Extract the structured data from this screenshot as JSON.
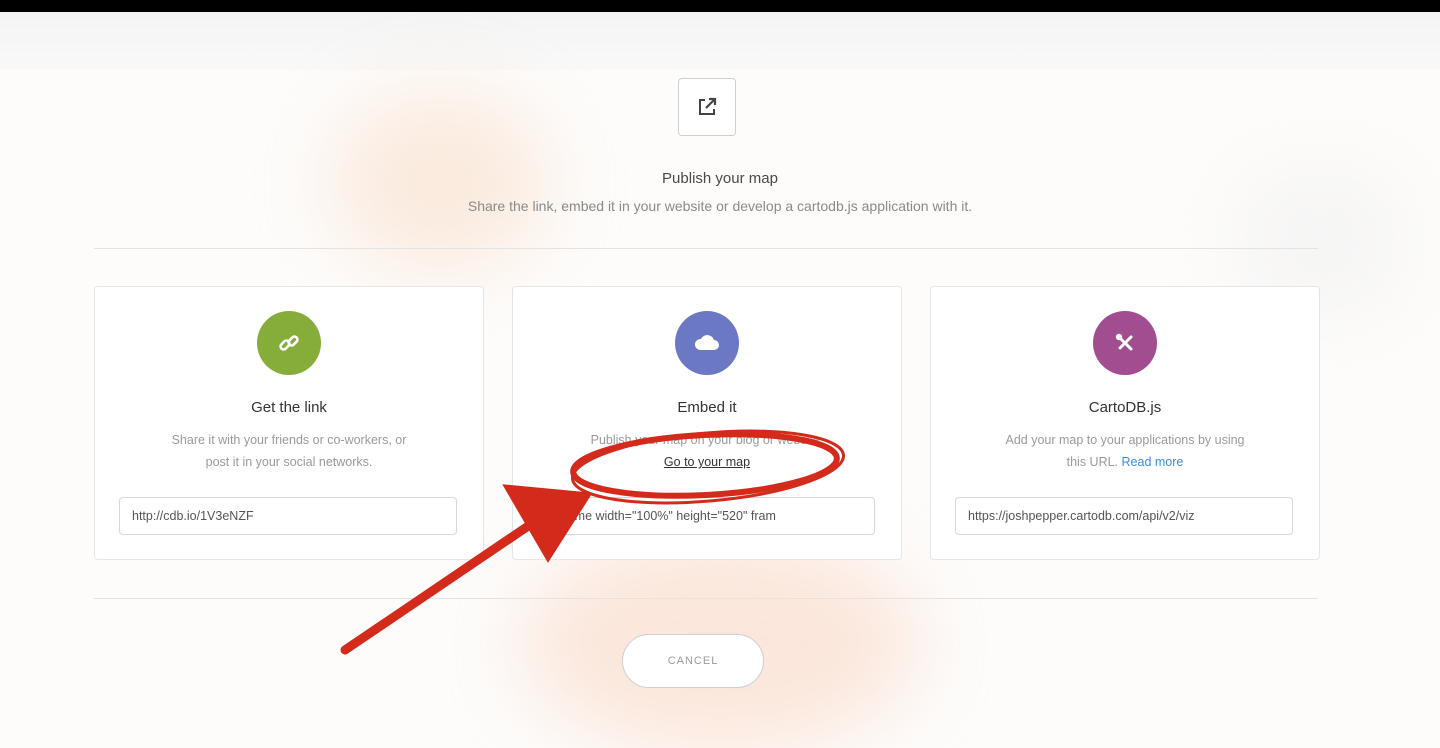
{
  "header": {
    "icon": "external-link-icon",
    "title": "Publish your map",
    "subtitle": "Share the link, embed it in your website or develop a cartodb.js application with it."
  },
  "cards": [
    {
      "icon": "link-icon",
      "icon_color": "#86ad3a",
      "title": "Get the link",
      "desc_line1": "Share it with your friends or co-workers, or",
      "desc_line2": "post it in your social networks.",
      "value": "http://cdb.io/1V3eNZF"
    },
    {
      "icon": "cloud-icon",
      "icon_color": "#6b79c4",
      "title": "Embed it",
      "desc_line1": "Publish your map on your blog or website.",
      "link": "Go to your map",
      "value": "<iframe width=\"100%\" height=\"520\" fram"
    },
    {
      "icon": "tools-icon",
      "icon_color": "#a24d8f",
      "title": "CartoDB.js",
      "desc_line1": "Add your map to your applications by using",
      "desc_line2": "this URL.",
      "read_more": "Read more",
      "value": "https://joshpepper.cartodb.com/api/v2/viz"
    }
  ],
  "footer": {
    "cancel_label": "CANCEL"
  },
  "annotation": {
    "color": "#d42a1c"
  }
}
